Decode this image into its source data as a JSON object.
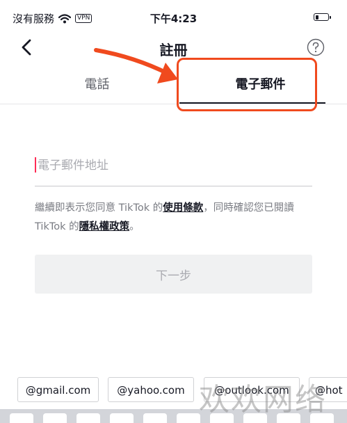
{
  "status_bar": {
    "carrier": "沒有服務",
    "vpn": "VPN",
    "time": "下午4:23",
    "battery_level_percent": 30
  },
  "nav": {
    "title": "註冊"
  },
  "tabs": [
    {
      "label": "電話",
      "active": false
    },
    {
      "label": "電子郵件",
      "active": true
    }
  ],
  "email": {
    "placeholder": "電子郵件地址",
    "value": ""
  },
  "terms": {
    "text_1": "繼續即表示您同意 TikTok 的",
    "terms_link": "使用條款",
    "text_2": "，同時確認您已閱讀 TikTok 的",
    "privacy_link": "隱私權政策",
    "text_3": "。"
  },
  "next_button": {
    "label": "下一步"
  },
  "domain_suggestions": [
    "@gmail.com",
    "@yahoo.com",
    "@outlook.com",
    "@hot"
  ],
  "watermark": "欢欢网络",
  "colors": {
    "accent": "#fe2c55",
    "annotation": "#f04a1e",
    "text_primary": "#161823",
    "text_secondary": "#7a7c83",
    "button_disabled_bg": "#f0f1f2",
    "button_disabled_text": "#a9aab0"
  },
  "icons": {
    "wifi": "wifi-icon",
    "battery": "battery-icon",
    "back": "chevron-left-icon",
    "help": "question-circle-icon",
    "annotation_arrow": "arrow-icon"
  }
}
